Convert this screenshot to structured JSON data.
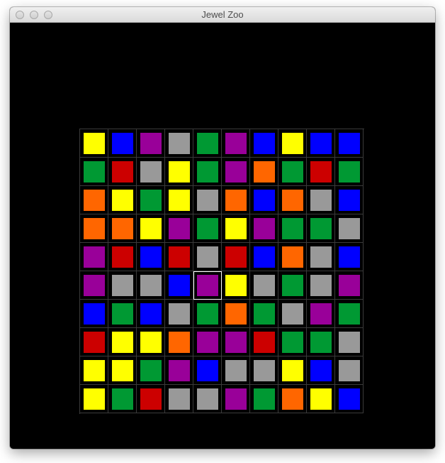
{
  "window": {
    "title": "Jewel Zoo"
  },
  "colors": {
    "Y": "#ffff00",
    "B": "#0000ff",
    "P": "#990099",
    "G": "#999999",
    "N": "#009933",
    "R": "#cc0000",
    "O": "#ff6600"
  },
  "board": {
    "rows": [
      [
        "Y",
        "B",
        "P",
        "G",
        "N",
        "P",
        "B",
        "Y",
        "B",
        "B"
      ],
      [
        "N",
        "R",
        "G",
        "Y",
        "N",
        "P",
        "O",
        "N",
        "R",
        "N"
      ],
      [
        "O",
        "Y",
        "N",
        "Y",
        "G",
        "O",
        "B",
        "O",
        "G",
        "B"
      ],
      [
        "O",
        "O",
        "Y",
        "P",
        "N",
        "Y",
        "P",
        "N",
        "N",
        "G"
      ],
      [
        "P",
        "R",
        "B",
        "R",
        "G",
        "R",
        "B",
        "O",
        "G",
        "B"
      ],
      [
        "P",
        "G",
        "G",
        "B",
        "P",
        "Y",
        "G",
        "N",
        "G",
        "P"
      ],
      [
        "B",
        "N",
        "B",
        "G",
        "N",
        "O",
        "N",
        "G",
        "P",
        "N"
      ],
      [
        "R",
        "Y",
        "Y",
        "O",
        "P",
        "P",
        "R",
        "N",
        "N",
        "G"
      ],
      [
        "Y",
        "Y",
        "N",
        "P",
        "B",
        "G",
        "G",
        "Y",
        "B",
        "G"
      ],
      [
        "Y",
        "N",
        "R",
        "G",
        "G",
        "P",
        "N",
        "O",
        "Y",
        "B"
      ]
    ],
    "selected": {
      "row": 5,
      "col": 4
    }
  }
}
